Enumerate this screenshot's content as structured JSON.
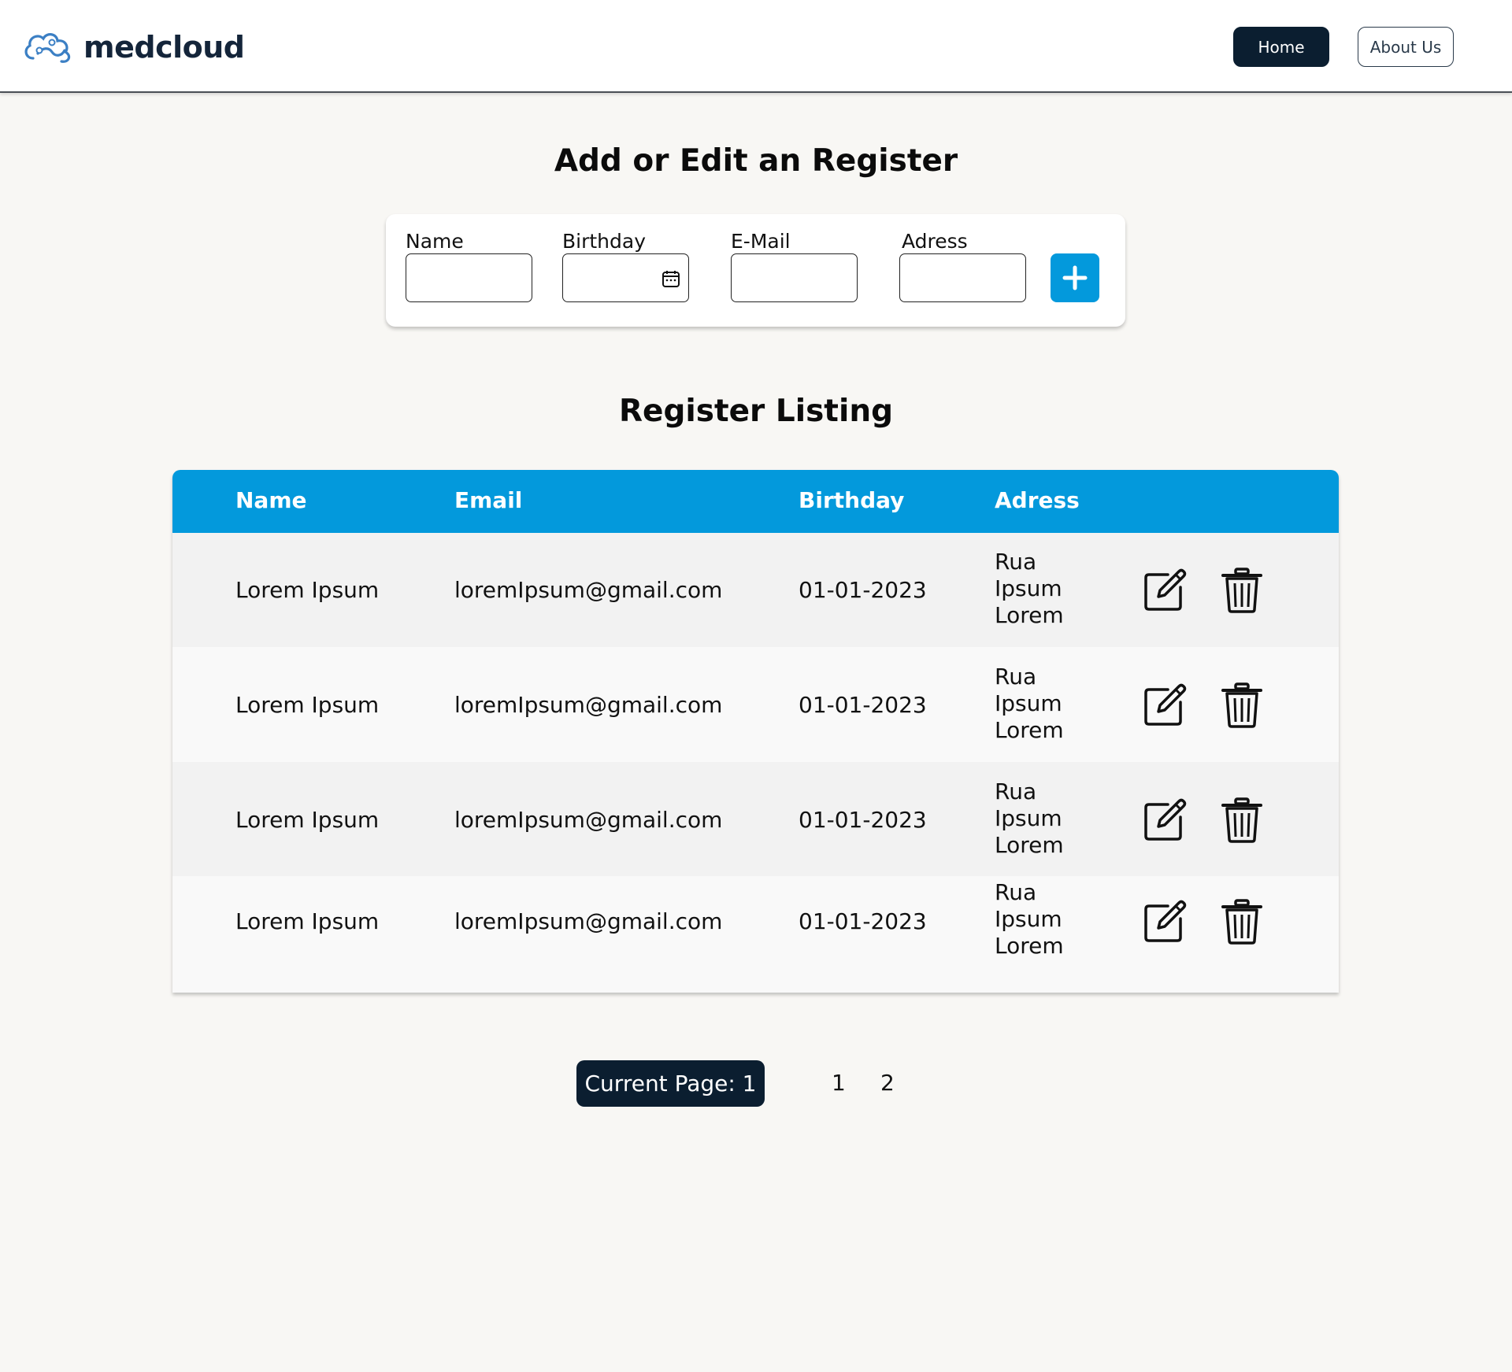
{
  "header": {
    "logo_text": "medcloud",
    "nav": {
      "home": "Home",
      "about": "About Us"
    }
  },
  "form": {
    "title": "Add or Edit an Register",
    "fields": {
      "name": {
        "label": "Name",
        "value": ""
      },
      "birthday": {
        "label": "Birthday",
        "value": ""
      },
      "email": {
        "label": "E-Mail",
        "value": ""
      },
      "address": {
        "label": "Adress",
        "value": ""
      }
    },
    "add_icon": "plus-icon"
  },
  "listing": {
    "title": "Register Listing",
    "columns": [
      "Name",
      "Email",
      "Birthday",
      "Adress"
    ],
    "rows": [
      {
        "name": "Lorem Ipsum",
        "email": "loremIpsum@gmail.com",
        "birthday": "01-01-2023",
        "address": [
          "Rua",
          "Ipsum",
          "Lorem"
        ]
      },
      {
        "name": "Lorem Ipsum",
        "email": "loremIpsum@gmail.com",
        "birthday": "01-01-2023",
        "address": [
          "Rua",
          "Ipsum",
          "Lorem"
        ]
      },
      {
        "name": "Lorem Ipsum",
        "email": "loremIpsum@gmail.com",
        "birthday": "01-01-2023",
        "address": [
          "Rua",
          "Ipsum",
          "Lorem"
        ]
      },
      {
        "name": "Lorem Ipsum",
        "email": "loremIpsum@gmail.com",
        "birthday": "01-01-2023",
        "address": [
          "Rua",
          "Ipsum",
          "Lorem"
        ]
      }
    ],
    "row_icons": {
      "edit": "edit-icon",
      "delete": "trash-icon"
    }
  },
  "pagination": {
    "current_label": "Current Page: 1",
    "pages": [
      "1",
      "2"
    ]
  },
  "colors": {
    "accent": "#0399dc",
    "dark": "#0b1e30",
    "background": "#f8f7f4"
  }
}
